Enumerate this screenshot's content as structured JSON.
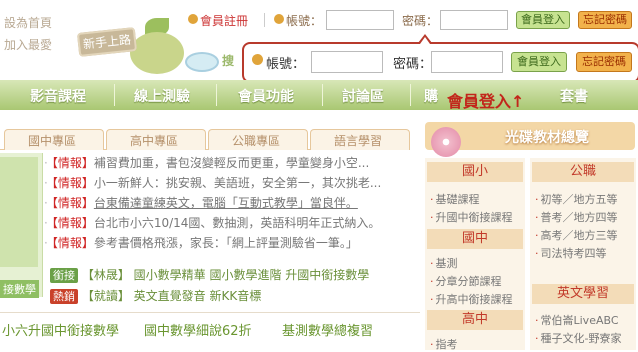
{
  "left_links": [
    "設為首頁",
    "加入最愛"
  ],
  "mascot_sign": "新手上路",
  "search_fragment": "搜",
  "top_bar": {
    "register": "會員註冊",
    "account_label": "帳號：",
    "password_label": "密碼：",
    "login_button": "會員登入",
    "forgot_button": "忘記密碼"
  },
  "popup": {
    "account_label": "帳號：",
    "password_label": "密碼：",
    "login_button": "會員登入",
    "forgot_button": "忘記密碼"
  },
  "callout": "會員登入↑",
  "nav": [
    "影音課程",
    "線上測驗",
    "會員功能",
    "討論區",
    "購",
    "套書"
  ],
  "tabs": [
    "國中專區",
    "高中專區",
    "公職專區",
    "語言學習"
  ],
  "news": [
    {
      "tag": "【情報】",
      "text": "補習費加重，書包沒變輕反而更重，學童變身小空..."
    },
    {
      "tag": "【情報】",
      "text": "小一新鮮人：挑安親、美語班，安全第一，其次挑老..."
    },
    {
      "tag": "【情報】",
      "text": "台東備達童練英文，電腦「互動式教學」當良伴。",
      "underline": true
    },
    {
      "tag": "【情報】",
      "text": "台北市小六10/14國、數抽測，英語科明年正式納入。"
    },
    {
      "tag": "【情報】",
      "text": "參考書價格飛漲，家長：「網上評量測驗省一筆。」"
    }
  ],
  "promo_rows": [
    {
      "badge": "銜接",
      "badge_color": "#6aa047",
      "text": "【林晟】 國小數學精華  國小數學進階  升國中銜接數學"
    },
    {
      "badge": "熱銷",
      "badge_color": "#c9412a",
      "text": "【就讀】 英文直覺發音  新KK音標"
    }
  ],
  "left_tile_label": "接數學",
  "bottom_links": [
    "小六升國中銜接數學",
    "國中數學細說62折",
    "基測數學總複習"
  ],
  "sidebar": {
    "title": "光碟教材總覽",
    "col1": [
      {
        "type": "cat",
        "label": "國小"
      },
      {
        "type": "item",
        "label": "基礎課程"
      },
      {
        "type": "item",
        "label": "升國中銜接課程"
      },
      {
        "type": "cat",
        "label": "國中"
      },
      {
        "type": "item",
        "label": "基測"
      },
      {
        "type": "item",
        "label": "分章分節課程"
      },
      {
        "type": "item",
        "label": "升高中銜接課程"
      },
      {
        "type": "cat",
        "label": "高中"
      },
      {
        "type": "item",
        "label": "指考"
      }
    ],
    "col2": [
      {
        "type": "cat",
        "label": "公職"
      },
      {
        "type": "item",
        "label": "初等／地方五等"
      },
      {
        "type": "item",
        "label": "普考／地方四等"
      },
      {
        "type": "item",
        "label": "高考／地方三等"
      },
      {
        "type": "item",
        "label": "司法特考四等"
      },
      {
        "type": "cat",
        "label": "英文學習"
      },
      {
        "type": "item",
        "label": "常伯崙LiveABC"
      },
      {
        "type": "item",
        "label": "種子文化-野寮家"
      }
    ]
  },
  "colors": {
    "brand_green": "#a9c772",
    "accent_red": "#b83a2c",
    "sidebar_cat": "#f3dcb8"
  }
}
